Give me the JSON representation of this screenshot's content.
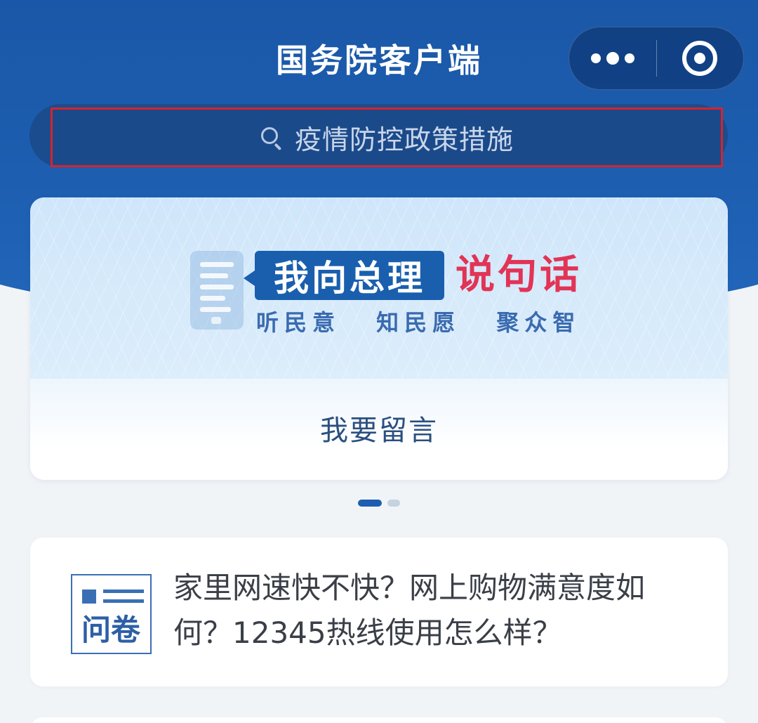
{
  "header": {
    "title": "国务院客户端"
  },
  "capsule": {
    "more_icon": "more-dots-icon",
    "close_icon": "target-close-icon"
  },
  "search": {
    "icon": "search-icon",
    "placeholder": "疫情防控政策措施"
  },
  "banner": {
    "highlight_title": "我向总理",
    "red_title": "说句话",
    "slogans": [
      "听民意",
      "知民愿",
      "聚众智"
    ],
    "action_label": "我要留言",
    "page_count": 2,
    "active_page": 1
  },
  "survey": {
    "icon_label": "问卷",
    "text": "家里网速快不快？网上购物满意度如何？12345热线使用怎么样？"
  },
  "colors": {
    "header_blue": "#1d5eb0",
    "search_outline": "#d8232a",
    "title_red": "#e23456"
  }
}
